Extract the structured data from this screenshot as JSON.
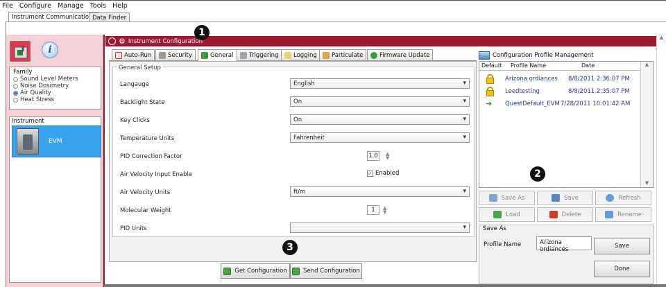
{
  "menu": [
    "File",
    "Configure",
    "Manage",
    "Tools",
    "Help"
  ],
  "top_tabs": [
    "Instrument Communications",
    "Data Finder"
  ],
  "sidebar": {
    "family_title": "Family",
    "family_items": [
      {
        "label": "Sound Level Meters",
        "selected": false
      },
      {
        "label": "Noise Dosimetry",
        "selected": false
      },
      {
        "label": "Air Quality",
        "selected": true
      },
      {
        "label": "Heat Stress",
        "selected": false
      }
    ],
    "instrument_title": "Instrument",
    "instrument_name": "EVM"
  },
  "window_title": "Instrument Configuration",
  "callouts": [
    "1",
    "2",
    "3"
  ],
  "tabs": [
    "Auto-Run",
    "Security",
    "General",
    "Triggering",
    "Logging",
    "Particulate",
    "Firmware Update"
  ],
  "active_tab": "General",
  "general_setup": {
    "title": "General Setup",
    "rows": [
      {
        "label": "Langauge",
        "type": "dropdown",
        "value": "English"
      },
      {
        "label": "Backlight State",
        "type": "dropdown",
        "value": "On"
      },
      {
        "label": "Key Clicks",
        "type": "dropdown",
        "value": "On"
      },
      {
        "label": "Temperature Units",
        "type": "dropdown",
        "value": "Fahrenheit"
      },
      {
        "label": "PID Correction Factor",
        "type": "spinner",
        "value": "1.0"
      },
      {
        "label": "Air Velocity Input Enable",
        "type": "checkbox",
        "value": "Enabled",
        "checked": true
      },
      {
        "label": "Air Velocity Units",
        "type": "dropdown",
        "value": "ft/m"
      },
      {
        "label": "Molecular Weight",
        "type": "spinner",
        "value": "1"
      },
      {
        "label": "PID Units",
        "type": "dropdown",
        "value": ""
      }
    ]
  },
  "buttons": {
    "get": "Get Configuration",
    "send": "Send Configuration"
  },
  "profile_mgmt": {
    "title": "Configuration Profile Management",
    "columns": [
      "Default",
      "Profile Name",
      "Date"
    ],
    "rows": [
      {
        "icon": "lock-icon",
        "name": "Arizona ordiances",
        "date": "8/8/2011 2:36:07 PM"
      },
      {
        "icon": "lock-icon",
        "name": "Leedtesting",
        "date": "8/8/2011 2:35:07 PM"
      },
      {
        "icon": "arrow-right-icon",
        "name": "QuestDefault_EVM",
        "date": "7/28/2011 10:01:42 AM"
      }
    ],
    "actions": [
      "Save As",
      "Save",
      "Refresh",
      "Load",
      "Delete",
      "Rename"
    ],
    "save_as": {
      "title": "Save As",
      "label": "Profile Name",
      "value": "Arizona ordiances",
      "save": "Save",
      "done": "Done"
    }
  }
}
